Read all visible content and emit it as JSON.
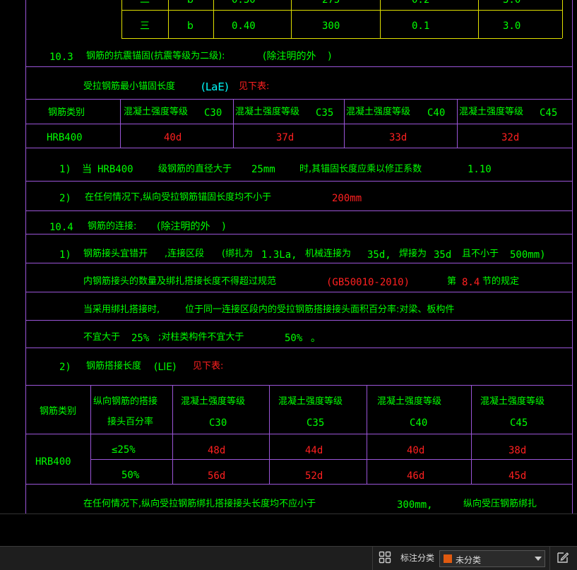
{
  "top_table": {
    "row_partial": [
      "二",
      "b",
      "0.30",
      "275",
      "0.2",
      "3.0"
    ],
    "row": [
      "三",
      "b",
      "0.40",
      "300",
      "0.1",
      "3.0"
    ]
  },
  "sec_10_3": {
    "num": "10.3",
    "title": "钢筋的抗震锚固(抗震等级为二级):",
    "note_open": "(除注明的外",
    "note_close": ")",
    "anchor_label": "受拉钢筋最小锚固长度",
    "anchor_symbol": "(LaE)",
    "see_below": "见下表:"
  },
  "anchor_table": {
    "col0": "钢筋类别",
    "grade_label": "混凝土强度等级",
    "grades": [
      "C30",
      "C35",
      "C40",
      "C45"
    ],
    "row_type": "HRB400",
    "values": [
      "40d",
      "37d",
      "33d",
      "32d"
    ]
  },
  "note1": {
    "num": "1)",
    "when": "当",
    "type": "HRB400",
    "text1": "级钢筋的直径大于",
    "dia": "25mm",
    "text2": "时,其锚固长度应乘以修正系数",
    "factor": "1.10"
  },
  "note2": {
    "num": "2)",
    "text": "在任何情况下,纵向受拉钢筋锚固长度均不小于",
    "value": "200mm"
  },
  "sec_10_4": {
    "num": "10.4",
    "title": "钢筋的连接:",
    "note_open": "(除注明的外",
    "note_close": ")"
  },
  "conn1": {
    "num": "1)",
    "a": "钢筋接头宜错开",
    "b": ",连接区段",
    "c": "(绑扎为",
    "c_val": "1.3La,",
    "d": "机械连接为",
    "d_val": "35d,",
    "e": "焊接为",
    "e_val": "35d",
    "f": "且不小于",
    "f_val": "500mm)"
  },
  "conn_line2": {
    "text": "内钢筋接头的数量及绑扎搭接长度不得超过规范",
    "code": "(GB50010-2010)",
    "di": "第",
    "clause": "8.4",
    "tail": "节的规定"
  },
  "conn_line3": {
    "a": "当采用绑扎搭接时,",
    "b": "位于同一连接区段内的受拉钢筋搭接接头面积百分率:对梁、板构件"
  },
  "conn_line4": {
    "a": "不宜大于",
    "b": "25%",
    "c": ";对柱类构件不宜大于",
    "d": "50%",
    "e": "。"
  },
  "conn2": {
    "num": "2)",
    "label": "钢筋搭接长度",
    "symbol": "(LlE)",
    "see_below": "见下表:"
  },
  "lap_table": {
    "col0": "钢筋类别",
    "col1_a": "纵向钢筋的搭接",
    "col1_b": "接头百分率",
    "grade_label": "混凝土强度等级",
    "grades": [
      "C30",
      "C35",
      "C40",
      "C45"
    ],
    "row_type": "HRB400",
    "pct_rows": [
      {
        "pct": "≤25%",
        "values": [
          "48d",
          "44d",
          "40d",
          "38d"
        ]
      },
      {
        "pct": "50%",
        "values": [
          "56d",
          "52d",
          "46d",
          "45d"
        ]
      }
    ]
  },
  "last_line": {
    "a": "在任何情况下,纵向受拉钢筋绑扎搭接接头长度均不应小于",
    "b": "300mm,",
    "c": "纵向受压钢筋绑扎"
  },
  "statusbar": {
    "annot_label": "标注分类",
    "category_value": "未分类",
    "category_color": "#e05a10"
  }
}
